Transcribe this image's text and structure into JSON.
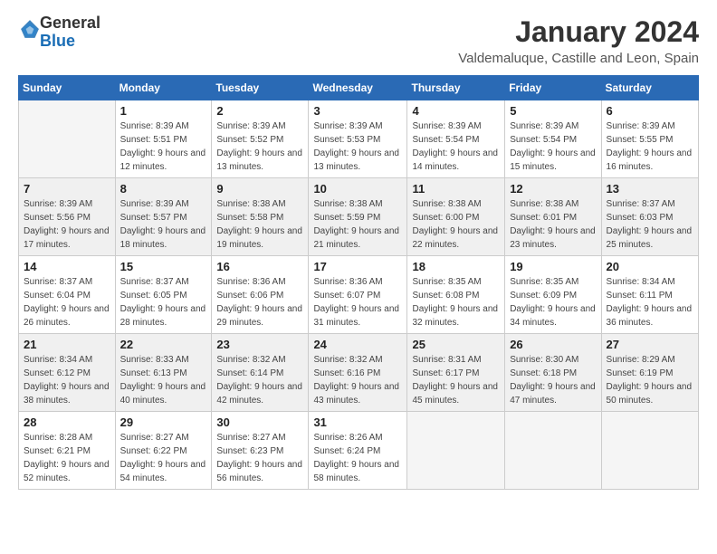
{
  "logo": {
    "general": "General",
    "blue": "Blue"
  },
  "title": "January 2024",
  "subtitle": "Valdemaluque, Castille and Leon, Spain",
  "days_of_week": [
    "Sunday",
    "Monday",
    "Tuesday",
    "Wednesday",
    "Thursday",
    "Friday",
    "Saturday"
  ],
  "weeks": [
    [
      {
        "day": "",
        "sunrise": "",
        "sunset": "",
        "daylight": "",
        "empty": true
      },
      {
        "day": "1",
        "sunrise": "Sunrise: 8:39 AM",
        "sunset": "Sunset: 5:51 PM",
        "daylight": "Daylight: 9 hours and 12 minutes."
      },
      {
        "day": "2",
        "sunrise": "Sunrise: 8:39 AM",
        "sunset": "Sunset: 5:52 PM",
        "daylight": "Daylight: 9 hours and 13 minutes."
      },
      {
        "day": "3",
        "sunrise": "Sunrise: 8:39 AM",
        "sunset": "Sunset: 5:53 PM",
        "daylight": "Daylight: 9 hours and 13 minutes."
      },
      {
        "day": "4",
        "sunrise": "Sunrise: 8:39 AM",
        "sunset": "Sunset: 5:54 PM",
        "daylight": "Daylight: 9 hours and 14 minutes."
      },
      {
        "day": "5",
        "sunrise": "Sunrise: 8:39 AM",
        "sunset": "Sunset: 5:54 PM",
        "daylight": "Daylight: 9 hours and 15 minutes."
      },
      {
        "day": "6",
        "sunrise": "Sunrise: 8:39 AM",
        "sunset": "Sunset: 5:55 PM",
        "daylight": "Daylight: 9 hours and 16 minutes."
      }
    ],
    [
      {
        "day": "7",
        "sunrise": "Sunrise: 8:39 AM",
        "sunset": "Sunset: 5:56 PM",
        "daylight": "Daylight: 9 hours and 17 minutes."
      },
      {
        "day": "8",
        "sunrise": "Sunrise: 8:39 AM",
        "sunset": "Sunset: 5:57 PM",
        "daylight": "Daylight: 9 hours and 18 minutes."
      },
      {
        "day": "9",
        "sunrise": "Sunrise: 8:38 AM",
        "sunset": "Sunset: 5:58 PM",
        "daylight": "Daylight: 9 hours and 19 minutes."
      },
      {
        "day": "10",
        "sunrise": "Sunrise: 8:38 AM",
        "sunset": "Sunset: 5:59 PM",
        "daylight": "Daylight: 9 hours and 21 minutes."
      },
      {
        "day": "11",
        "sunrise": "Sunrise: 8:38 AM",
        "sunset": "Sunset: 6:00 PM",
        "daylight": "Daylight: 9 hours and 22 minutes."
      },
      {
        "day": "12",
        "sunrise": "Sunrise: 8:38 AM",
        "sunset": "Sunset: 6:01 PM",
        "daylight": "Daylight: 9 hours and 23 minutes."
      },
      {
        "day": "13",
        "sunrise": "Sunrise: 8:37 AM",
        "sunset": "Sunset: 6:03 PM",
        "daylight": "Daylight: 9 hours and 25 minutes."
      }
    ],
    [
      {
        "day": "14",
        "sunrise": "Sunrise: 8:37 AM",
        "sunset": "Sunset: 6:04 PM",
        "daylight": "Daylight: 9 hours and 26 minutes."
      },
      {
        "day": "15",
        "sunrise": "Sunrise: 8:37 AM",
        "sunset": "Sunset: 6:05 PM",
        "daylight": "Daylight: 9 hours and 28 minutes."
      },
      {
        "day": "16",
        "sunrise": "Sunrise: 8:36 AM",
        "sunset": "Sunset: 6:06 PM",
        "daylight": "Daylight: 9 hours and 29 minutes."
      },
      {
        "day": "17",
        "sunrise": "Sunrise: 8:36 AM",
        "sunset": "Sunset: 6:07 PM",
        "daylight": "Daylight: 9 hours and 31 minutes."
      },
      {
        "day": "18",
        "sunrise": "Sunrise: 8:35 AM",
        "sunset": "Sunset: 6:08 PM",
        "daylight": "Daylight: 9 hours and 32 minutes."
      },
      {
        "day": "19",
        "sunrise": "Sunrise: 8:35 AM",
        "sunset": "Sunset: 6:09 PM",
        "daylight": "Daylight: 9 hours and 34 minutes."
      },
      {
        "day": "20",
        "sunrise": "Sunrise: 8:34 AM",
        "sunset": "Sunset: 6:11 PM",
        "daylight": "Daylight: 9 hours and 36 minutes."
      }
    ],
    [
      {
        "day": "21",
        "sunrise": "Sunrise: 8:34 AM",
        "sunset": "Sunset: 6:12 PM",
        "daylight": "Daylight: 9 hours and 38 minutes."
      },
      {
        "day": "22",
        "sunrise": "Sunrise: 8:33 AM",
        "sunset": "Sunset: 6:13 PM",
        "daylight": "Daylight: 9 hours and 40 minutes."
      },
      {
        "day": "23",
        "sunrise": "Sunrise: 8:32 AM",
        "sunset": "Sunset: 6:14 PM",
        "daylight": "Daylight: 9 hours and 42 minutes."
      },
      {
        "day": "24",
        "sunrise": "Sunrise: 8:32 AM",
        "sunset": "Sunset: 6:16 PM",
        "daylight": "Daylight: 9 hours and 43 minutes."
      },
      {
        "day": "25",
        "sunrise": "Sunrise: 8:31 AM",
        "sunset": "Sunset: 6:17 PM",
        "daylight": "Daylight: 9 hours and 45 minutes."
      },
      {
        "day": "26",
        "sunrise": "Sunrise: 8:30 AM",
        "sunset": "Sunset: 6:18 PM",
        "daylight": "Daylight: 9 hours and 47 minutes."
      },
      {
        "day": "27",
        "sunrise": "Sunrise: 8:29 AM",
        "sunset": "Sunset: 6:19 PM",
        "daylight": "Daylight: 9 hours and 50 minutes."
      }
    ],
    [
      {
        "day": "28",
        "sunrise": "Sunrise: 8:28 AM",
        "sunset": "Sunset: 6:21 PM",
        "daylight": "Daylight: 9 hours and 52 minutes."
      },
      {
        "day": "29",
        "sunrise": "Sunrise: 8:27 AM",
        "sunset": "Sunset: 6:22 PM",
        "daylight": "Daylight: 9 hours and 54 minutes."
      },
      {
        "day": "30",
        "sunrise": "Sunrise: 8:27 AM",
        "sunset": "Sunset: 6:23 PM",
        "daylight": "Daylight: 9 hours and 56 minutes."
      },
      {
        "day": "31",
        "sunrise": "Sunrise: 8:26 AM",
        "sunset": "Sunset: 6:24 PM",
        "daylight": "Daylight: 9 hours and 58 minutes."
      },
      {
        "day": "",
        "sunrise": "",
        "sunset": "",
        "daylight": "",
        "empty": true
      },
      {
        "day": "",
        "sunrise": "",
        "sunset": "",
        "daylight": "",
        "empty": true
      },
      {
        "day": "",
        "sunrise": "",
        "sunset": "",
        "daylight": "",
        "empty": true
      }
    ]
  ]
}
